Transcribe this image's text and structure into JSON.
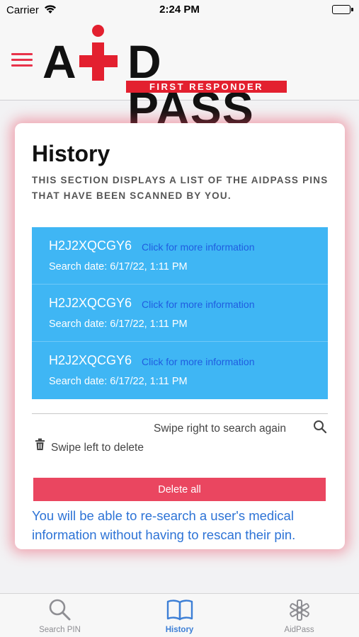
{
  "status_bar": {
    "carrier": "Carrier",
    "time": "2:24 PM"
  },
  "header": {
    "logo": {
      "text_left": "A",
      "text_right": "D PASS",
      "tagline": "FIRST RESPONDER"
    }
  },
  "card": {
    "title": "History",
    "description": "THIS SECTION DISPLAYS A LIST OF THE AIDPASS PINS THAT HAVE BEEN SCANNED BY YOU.",
    "items": [
      {
        "pin": "H2J2XQCGY6",
        "link": "Click for more information",
        "date": "Search date: 6/17/22, 1:11 PM"
      },
      {
        "pin": "H2J2XQCGY6",
        "link": "Click for more information",
        "date": "Search date: 6/17/22, 1:11 PM"
      },
      {
        "pin": "H2J2XQCGY6",
        "link": "Click for more information",
        "date": "Search date: 6/17/22, 1:11 PM"
      }
    ],
    "swipe_right_hint": "Swipe right to search again",
    "swipe_left_hint": "Swipe left to delete",
    "delete_all_label": "Delete all",
    "note": "You will be able to re-search a user's medical information without having to rescan their pin."
  },
  "tab_bar": {
    "tabs": [
      {
        "label": "Search PIN",
        "icon": "search-icon"
      },
      {
        "label": "History",
        "icon": "book-icon"
      },
      {
        "label": "AidPass",
        "icon": "asterisk-icon"
      }
    ],
    "active": "History"
  },
  "colors": {
    "brand_red": "#e3202f",
    "list_blue": "#3fb6f4",
    "link_blue": "#1f5de0",
    "delete_red": "#ea4660",
    "tab_active": "#3d7fd6"
  }
}
